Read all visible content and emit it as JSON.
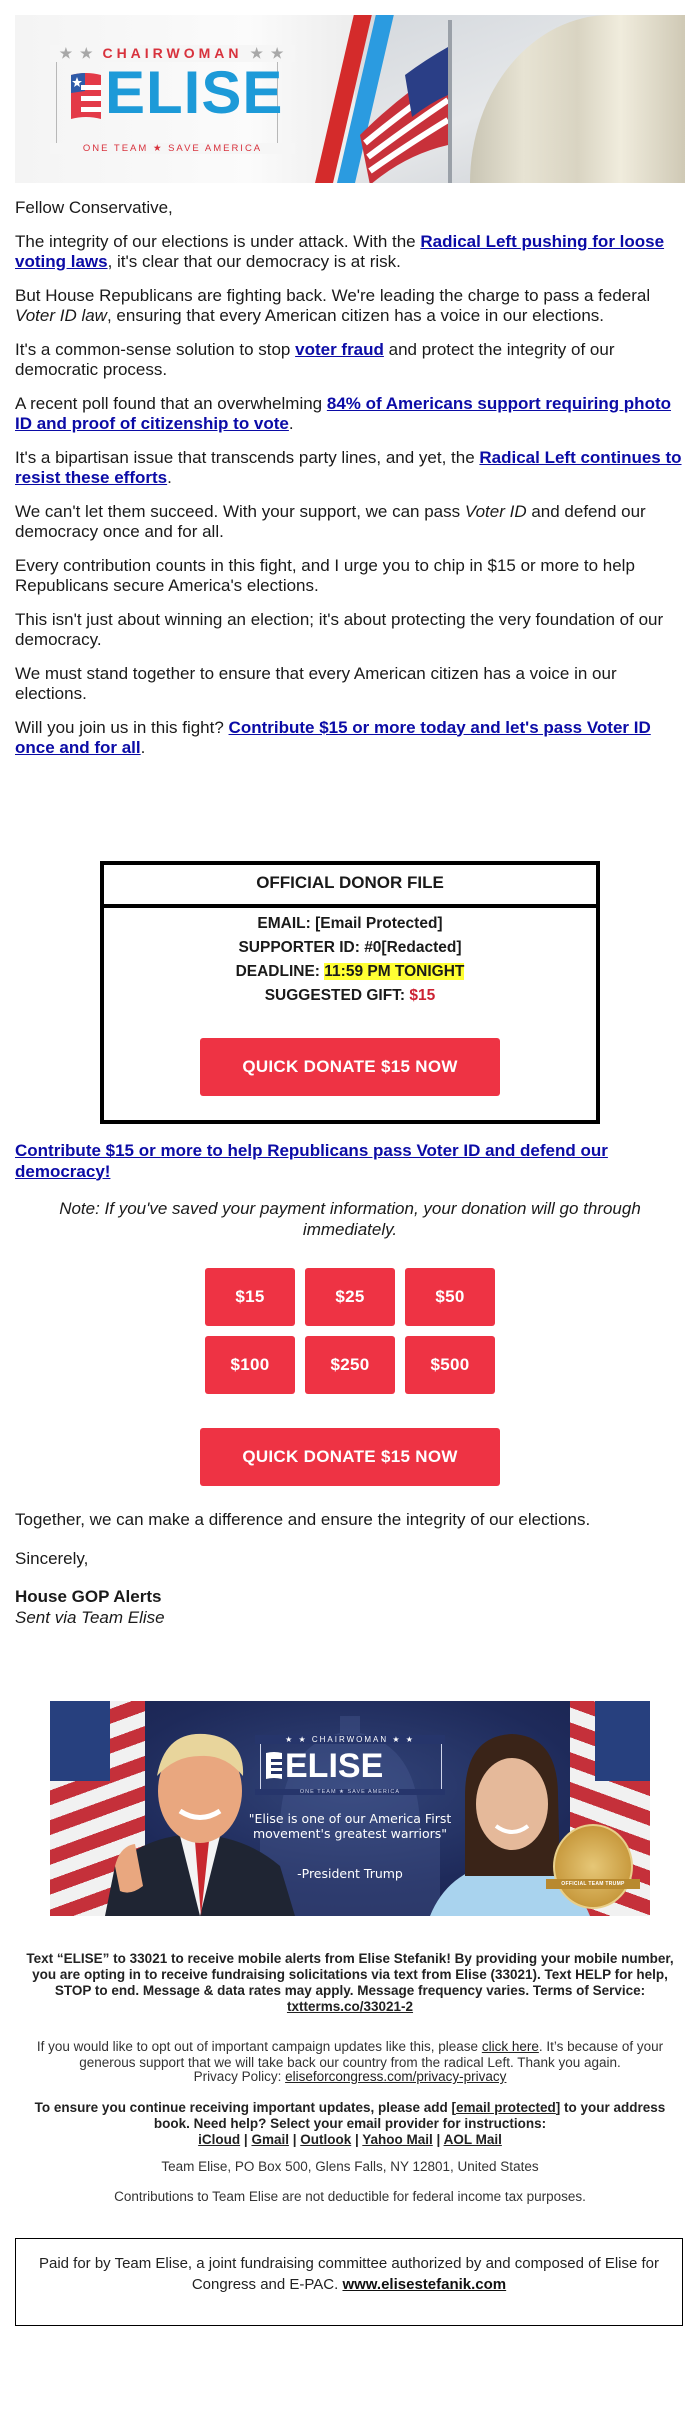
{
  "header": {
    "logo_top": "CHAIRWOMAN",
    "logo_stars": "★ ★",
    "logo_word": "ELISE",
    "logo_tagline": "ONE TEAM ★ SAVE AMERICA"
  },
  "body": {
    "greeting": "Fellow Conservative,",
    "p1_a": "The integrity of our elections is under attack. With the ",
    "p1_link": "Radical Left pushing for loose voting laws",
    "p1_b": ", it's clear that our democracy is at risk.",
    "p2_a": "But House Republicans are fighting back. We're leading the charge to pass a federal ",
    "p2_em": "Voter ID law",
    "p2_b": ", ensuring that every American citizen has a voice in our elections.",
    "p3_a": "It's a common-sense solution to stop ",
    "p3_link": "voter fraud",
    "p3_b": " and protect the integrity of our democratic process.",
    "p4_a": "A recent poll found that an overwhelming ",
    "p4_link": "84% of Americans support requiring photo ID and proof of citizenship to vote",
    "p4_b": ".",
    "p5_a": "It's a bipartisan issue that transcends party lines, and yet, the ",
    "p5_link": "Radical Left continues to resist these efforts",
    "p5_b": ".",
    "p6_a": "We can't let them succeed. With your support, we can pass ",
    "p6_em": "Voter ID",
    "p6_b": " and defend our democracy once and for all.",
    "p7": "Every contribution counts in this fight, and I urge you to chip in $15 or more to help Republicans secure America's elections.",
    "p8": "This isn't just about winning an election; it's about protecting the very foundation of our democracy.",
    "p9": "We must stand together to ensure that every American citizen has a voice in our elections.",
    "p10_a": "Will you join us in this fight? ",
    "p10_link": "Contribute $15 or more today and let's pass Voter ID once and for all",
    "p10_b": "."
  },
  "donor_file": {
    "title": "OFFICIAL DONOR FILE",
    "email_label": "EMAIL: ",
    "email_value": "[Email Protected]",
    "supporter_label": "SUPPORTER ID: ",
    "supporter_value": "#0[Redacted]",
    "deadline_label": "DEADLINE: ",
    "deadline_value": "11:59 PM TONIGHT",
    "gift_label": "SUGGESTED GIFT: ",
    "gift_value": "$15",
    "button_label": "QUICK DONATE $15 NOW"
  },
  "cta_link": "Contribute $15 or more to help Republicans pass Voter ID and defend our democracy!",
  "note": "Note: If you've saved your payment information, your donation will go through immediately.",
  "amounts": [
    "$15",
    "$25",
    "$50",
    "$100",
    "$250",
    "$500"
  ],
  "quick_donate_label": "QUICK DONATE $15 NOW",
  "closing": {
    "line": "Together, we can make a difference and ensure the integrity of our elections.",
    "signoff": "Sincerely,",
    "sender": "House GOP Alerts",
    "via": "Sent via Team Elise"
  },
  "banner": {
    "logo_top": "★ ★ CHAIRWOMAN ★ ★",
    "logo_word": "ELISE",
    "logo_tagline": "ONE TEAM ★ SAVE AMERICA",
    "quote": "\"Elise is one of our America First movement's greatest warriors\"",
    "attribution": "-President Trump",
    "badge_text": "OFFICIAL TEAM TRUMP"
  },
  "footer": {
    "sms_text": "Text “ELISE” to 33021 to receive mobile alerts from Elise Stefanik! By providing your mobile number, you are opting in to receive fundraising solicitations via text from Elise (33021). Text HELP for help, STOP to end. Message & data rates may apply. Message frequency varies. Terms of Service: ",
    "sms_link": "txtterms.co/33021-2",
    "optout_a": "If you would like to opt out of important campaign updates like this, please ",
    "optout_link": "click here",
    "optout_b": ". It’s because of your generous support that we will take back our country from the radical Left. Thank you again.",
    "privacy_label": "Privacy Policy: ",
    "privacy_link": "eliseforcongress.com/privacy-privacy",
    "addressbook_a": "To ensure you continue receiving important updates, please add [",
    "addressbook_link": "email protected",
    "addressbook_b": "] to your address book. Need help? Select your email provider for instructions:",
    "providers": [
      "iCloud",
      "Gmail",
      "Outlook",
      "Yahoo Mail",
      "AOL Mail"
    ],
    "separator": " | ",
    "address": "Team Elise, PO Box 500, Glens Falls, NY 12801, United States",
    "tax": "Contributions to Team Elise are not deductible for federal income tax purposes.",
    "paid_for": "Paid for by Team Elise, a joint fundraising committee authorized by and composed of Elise for Congress and E-PAC. ",
    "paid_link": "www.elisestefanik.com"
  },
  "colors": {
    "accent_red": "#ee3344",
    "link_blue": "#0b0ba6",
    "logo_blue": "#1d9ad8",
    "highlight": "#ffff33"
  }
}
